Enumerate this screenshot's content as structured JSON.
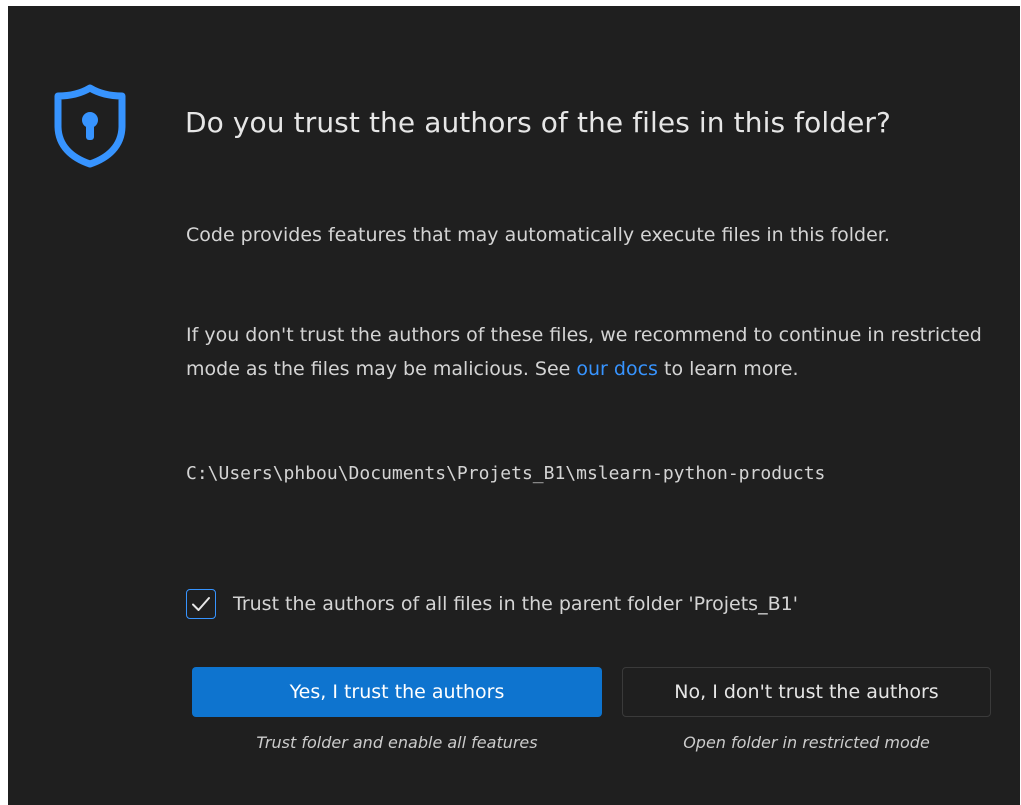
{
  "dialog": {
    "title": "Do you trust the authors of the files in this folder?",
    "paragraph1": "Code provides features that may automatically execute files in this folder.",
    "paragraph2_before": "If you don't trust the authors of these files, we recommend to continue in restricted mode as the files may be malicious. See ",
    "paragraph2_link": "our docs",
    "paragraph2_after": " to learn more.",
    "folder_path": "C:\\Users\\phbou\\Documents\\Projets_B1\\mslearn-python-products",
    "checkbox": {
      "label": "Trust the authors of all files in the parent folder 'Projets_B1'",
      "checked": true
    },
    "buttons": {
      "yes_label": "Yes, I trust the authors",
      "yes_sublabel": "Trust folder and enable all features",
      "no_label": "No, I don't trust the authors",
      "no_sublabel": "Open folder in restricted mode"
    },
    "icons": {
      "header": "shield-lock-icon",
      "checkbox": "checkmark-icon"
    }
  },
  "colors": {
    "background": "#1f1f1f",
    "accent": "#3794ff",
    "primary_button": "#0e74cf",
    "text": "#d4d4d4"
  }
}
